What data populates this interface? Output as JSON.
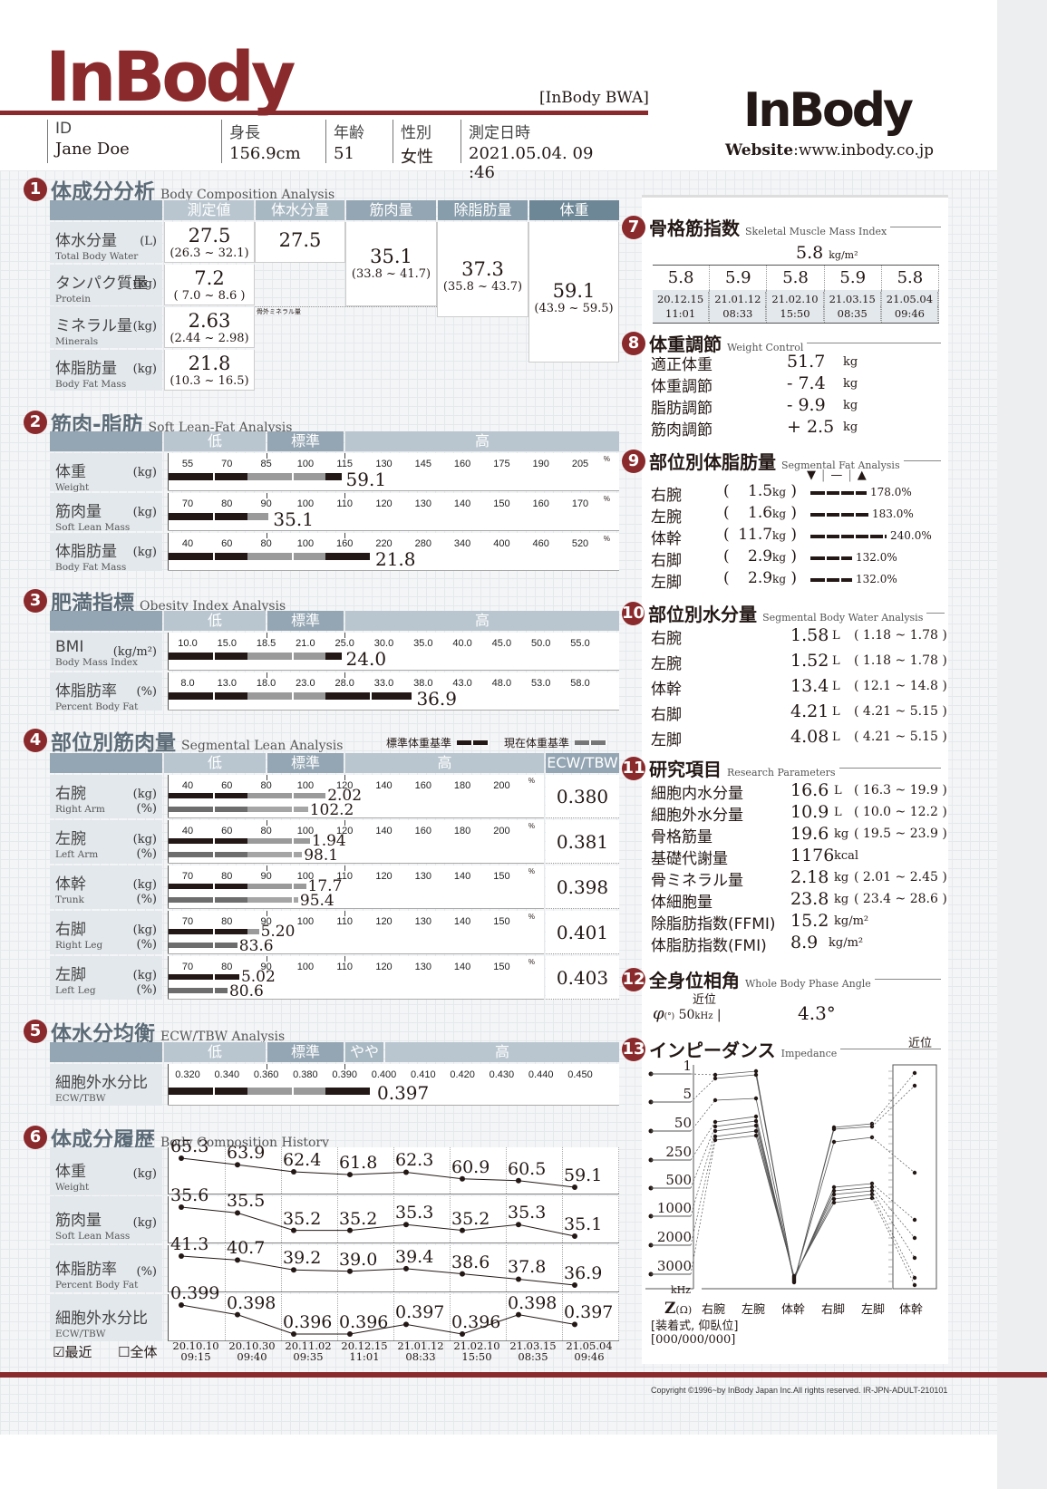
{
  "header": {
    "logo": "InBody",
    "model": "[InBody BWA]",
    "logo_right": "InBody",
    "website_label": "Website",
    "website_url": ":www.inbody.co.jp",
    "fields": [
      {
        "key": "ID",
        "value": "Jane Doe"
      },
      {
        "key": "身長",
        "value": "156.9cm"
      },
      {
        "key": "年齢",
        "value": "51"
      },
      {
        "key": "性別",
        "value": "女性"
      },
      {
        "key": "測定日時",
        "value": "2021.05.04. 09 :46"
      }
    ]
  },
  "sections": {
    "s1": {
      "num": "1",
      "jp": "体成分分析",
      "en": "Body Composition Analysis"
    },
    "s2": {
      "num": "2",
      "jp": "筋肉-脂肪",
      "en": "Soft Lean-Fat Analysis"
    },
    "s3": {
      "num": "3",
      "jp": "肥満指標",
      "en": "Obesity Index Analysis"
    },
    "s4": {
      "num": "4",
      "jp": "部位別筋肉量",
      "en": "Segmental Lean Analysis"
    },
    "s5": {
      "num": "5",
      "jp": "体水分均衡",
      "en": "ECW/TBW Analysis"
    },
    "s6": {
      "num": "6",
      "jp": "体成分履歴",
      "en": "Body Composition History"
    },
    "s7": {
      "num": "7",
      "jp": "骨格筋指数",
      "en": "Skeletal Muscle Mass Index"
    },
    "s8": {
      "num": "8",
      "jp": "体重調節",
      "en": "Weight Control"
    },
    "s9": {
      "num": "9",
      "jp": "部位別体脂肪量",
      "en": "Segmental Fat Analysis"
    },
    "s10": {
      "num": "10",
      "jp": "部位別水分量",
      "en": "Segmental Body Water Analysis"
    },
    "s11": {
      "num": "11",
      "jp": "研究項目",
      "en": "Research Parameters"
    },
    "s12": {
      "num": "12",
      "jp": "全身位相角",
      "en": "Whole Body Phase Angle"
    },
    "s13": {
      "num": "13",
      "jp": "インピーダンス",
      "en": "Impedance"
    }
  },
  "bca": {
    "headers": [
      "測定値",
      "体水分量",
      "筋肉量",
      "除脂肪量",
      "体重"
    ],
    "rows": [
      {
        "jp": "体水分量",
        "en": "Total Body Water",
        "unit": "(L)",
        "value": "27.5",
        "range": "(26.3 ~ 32.1)"
      },
      {
        "jp": "タンパク質量",
        "en": "Protein",
        "unit": "(kg)",
        "value": "7.2",
        "range": "( 7.0 ~ 8.6 )"
      },
      {
        "jp": "ミネラル量",
        "en": "Minerals",
        "unit": "(kg)",
        "value": "2.63",
        "range": "(2.44 ~ 2.98)"
      },
      {
        "jp": "体脂肪量",
        "en": "Body Fat Mass",
        "unit": "(kg)",
        "value": "21.8",
        "range": "(10.3 ~ 16.5)"
      }
    ],
    "tbw": "27.5",
    "slm": "35.1",
    "slm_range": "(33.8 ~ 41.7)",
    "ffm": "37.3",
    "ffm_range": "(35.8 ~ 43.7)",
    "weight": "59.1",
    "weight_range": "(43.9 ~ 59.5)",
    "bone_note": "骨外ミネラル量"
  },
  "range_headers": {
    "low": "低",
    "normal": "標準",
    "high": "高",
    "slightly_high": "やや高",
    "ecw": "ECW/TBW"
  },
  "slf": [
    {
      "jp": "体重",
      "en": "Weight",
      "unit": "(kg)",
      "ticks": [
        "55",
        "70",
        "85",
        "100",
        "115",
        "130",
        "145",
        "160",
        "175",
        "190",
        "205"
      ],
      "value": "59.1",
      "pos": 4.4
    },
    {
      "jp": "筋肉量",
      "en": "Soft Lean Mass",
      "unit": "(kg)",
      "ticks": [
        "70",
        "80",
        "90",
        "100",
        "110",
        "120",
        "130",
        "140",
        "150",
        "160",
        "170"
      ],
      "value": "35.1",
      "pos": 2.55
    },
    {
      "jp": "体脂肪量",
      "en": "Body Fat Mass",
      "unit": "(kg)",
      "ticks": [
        "40",
        "60",
        "80",
        "100",
        "160",
        "220",
        "280",
        "340",
        "400",
        "460",
        "520"
      ],
      "value": "21.8",
      "pos": 5.15
    }
  ],
  "obesity": [
    {
      "jp": "BMI",
      "en": "Body Mass Index",
      "unit": "(kg/m²)",
      "ticks": [
        "10.0",
        "15.0",
        "18.5",
        "21.0",
        "25.0",
        "30.0",
        "35.0",
        "40.0",
        "45.0",
        "50.0",
        "55.0"
      ],
      "value": "24.0",
      "pos": 4.4
    },
    {
      "jp": "体脂肪率",
      "en": "Percent Body Fat",
      "unit": "(%)",
      "ticks": [
        "8.0",
        "13.0",
        "18.0",
        "23.0",
        "28.0",
        "33.0",
        "38.0",
        "43.0",
        "48.0",
        "53.0",
        "58.0"
      ],
      "value": "36.9",
      "pos": 6.2
    }
  ],
  "segmental_lean": {
    "legend_std": "標準体重基準",
    "legend_cur": "現在体重基準",
    "rows": [
      {
        "jp": "右腕",
        "en": "Right Arm",
        "ticks": [
          "40",
          "60",
          "80",
          "100",
          "120",
          "140",
          "160",
          "180",
          "200"
        ],
        "kg": "2.02",
        "kg_pos": 4.0,
        "pct": "102.2",
        "pct_pos": 3.55,
        "ecw": "0.380"
      },
      {
        "jp": "左腕",
        "en": "Left Arm",
        "ticks": [
          "40",
          "60",
          "80",
          "100",
          "120",
          "140",
          "160",
          "180",
          "200"
        ],
        "kg": "1.94",
        "kg_pos": 3.6,
        "pct": "98.1",
        "pct_pos": 3.4,
        "ecw": "0.381"
      },
      {
        "jp": "体幹",
        "en": "Trunk",
        "ticks": [
          "70",
          "80",
          "90",
          "100",
          "110",
          "120",
          "130",
          "140",
          "150"
        ],
        "kg": "17.7",
        "kg_pos": 3.5,
        "pct": "95.4",
        "pct_pos": 3.3,
        "ecw": "0.398"
      },
      {
        "jp": "右脚",
        "en": "Right Leg",
        "ticks": [
          "70",
          "80",
          "90",
          "100",
          "110",
          "120",
          "130",
          "140",
          "150"
        ],
        "kg": "5.20",
        "kg_pos": 2.3,
        "pct": "83.6",
        "pct_pos": 1.75,
        "ecw": "0.401"
      },
      {
        "jp": "左脚",
        "en": "Left Leg",
        "ticks": [
          "70",
          "80",
          "90",
          "100",
          "110",
          "120",
          "130",
          "140",
          "150"
        ],
        "kg": "5.02",
        "kg_pos": 1.8,
        "pct": "80.6",
        "pct_pos": 1.5,
        "ecw": "0.403"
      }
    ]
  },
  "ecw": {
    "jp": "細胞外水分比",
    "en": "ECW/TBW",
    "ticks": [
      "0.320",
      "0.340",
      "0.360",
      "0.380",
      "0.390",
      "0.400",
      "0.410",
      "0.420",
      "0.430",
      "0.440",
      "0.450"
    ],
    "value": "0.397",
    "pos": 5.15
  },
  "history": {
    "rows": [
      {
        "jp": "体重",
        "en": "Weight",
        "unit": "(kg)",
        "values": [
          "65.3",
          "63.9",
          "62.4",
          "61.8",
          "62.3",
          "60.9",
          "60.5",
          "59.1"
        ]
      },
      {
        "jp": "筋肉量",
        "en": "Soft Lean Mass",
        "unit": "(kg)",
        "values": [
          "35.6",
          "35.5",
          "35.2",
          "35.2",
          "35.3",
          "35.2",
          "35.3",
          "35.1"
        ]
      },
      {
        "jp": "体脂肪率",
        "en": "Percent Body Fat",
        "unit": "(%)",
        "values": [
          "41.3",
          "40.7",
          "39.2",
          "39.0",
          "39.4",
          "38.6",
          "37.8",
          "36.9"
        ]
      },
      {
        "jp": "細胞外水分比",
        "en": "ECW/TBW",
        "unit": "",
        "values": [
          "0.399",
          "0.398",
          "0.396",
          "0.396",
          "0.397",
          "0.396",
          "0.398",
          "0.397"
        ]
      }
    ],
    "dates": [
      [
        "20.10.10",
        "09:15"
      ],
      [
        "20.10.30",
        "09:40"
      ],
      [
        "20.11.02",
        "09:35"
      ],
      [
        "20.12.15",
        "11:01"
      ],
      [
        "21.01.12",
        "08:33"
      ],
      [
        "21.02.10",
        "15:50"
      ],
      [
        "21.03.15",
        "08:35"
      ],
      [
        "21.05.04",
        "09:46"
      ]
    ],
    "recent_label": "最近",
    "all_label": "全体"
  },
  "smi": {
    "value": "5.8",
    "unit": "kg/m²",
    "history": [
      "5.8",
      "5.9",
      "5.8",
      "5.9",
      "5.8"
    ],
    "dates": [
      [
        "20.12.15",
        "11:01"
      ],
      [
        "21.01.12",
        "08:33"
      ],
      [
        "21.02.10",
        "15:50"
      ],
      [
        "21.03.15",
        "08:35"
      ],
      [
        "21.05.04",
        "09:46"
      ]
    ]
  },
  "weight_control": [
    {
      "k": "適正体重",
      "v": "51.7",
      "u": "kg"
    },
    {
      "k": "体重調節",
      "v": "- 7.4",
      "u": "kg"
    },
    {
      "k": "脂肪調節",
      "v": "- 9.9",
      "u": "kg"
    },
    {
      "k": "筋肉調節",
      "v": "+ 2.5",
      "u": "kg"
    }
  ],
  "segmental_fat": {
    "legend": [
      "▼",
      "|",
      "—",
      "|",
      "▲"
    ],
    "rows": [
      {
        "k": "右腕",
        "kg": "1.5",
        "pct": "178.0%",
        "level": 0.178
      },
      {
        "k": "左腕",
        "kg": "1.6",
        "pct": "183.0%",
        "level": 0.183
      },
      {
        "k": "体幹",
        "kg": "11.7",
        "pct": "240.0%",
        "level": 0.24
      },
      {
        "k": "右脚",
        "kg": "2.9",
        "pct": "132.0%",
        "level": 0.132
      },
      {
        "k": "左脚",
        "kg": "2.9",
        "pct": "132.0%",
        "level": 0.132
      }
    ]
  },
  "segmental_water": [
    {
      "k": "右腕",
      "v": "1.58",
      "u": "L",
      "r": "( 1.18 ~ 1.78 )"
    },
    {
      "k": "左腕",
      "v": "1.52",
      "u": "L",
      "r": "( 1.18 ~ 1.78 )"
    },
    {
      "k": "体幹",
      "v": "13.4",
      "u": "L",
      "r": "( 12.1 ~ 14.8 )"
    },
    {
      "k": "右脚",
      "v": "4.21",
      "u": "L",
      "r": "( 4.21 ~ 5.15 )"
    },
    {
      "k": "左脚",
      "v": "4.08",
      "u": "L",
      "r": "( 4.21 ~ 5.15 )"
    }
  ],
  "research": [
    {
      "k": "細胞内水分量",
      "v": "16.6",
      "u": "L",
      "r": "( 16.3 ~ 19.9 )"
    },
    {
      "k": "細胞外水分量",
      "v": "10.9",
      "u": "L",
      "r": "( 10.0 ~ 12.2 )"
    },
    {
      "k": "骨格筋量",
      "v": "19.6",
      "u": "kg",
      "r": "( 19.5 ~ 23.9 )"
    },
    {
      "k": "基礎代謝量",
      "v": "1176",
      "u": "kcal",
      "r": ""
    },
    {
      "k": "骨ミネラル量",
      "v": "2.18",
      "u": "kg",
      "r": "( 2.01 ~ 2.45 )"
    },
    {
      "k": "体細胞量",
      "v": "23.8",
      "u": "kg",
      "r": "( 23.4 ~ 28.6 )"
    },
    {
      "k": "除脂肪指数(FFMI)",
      "v": "15.2",
      "u": "kg/m²",
      "r": ""
    },
    {
      "k": "体脂肪指数(FMI)",
      "v": "8.9",
      "u": "kg/m²",
      "r": ""
    }
  ],
  "phase_angle": {
    "pos_label": "近位",
    "symbol": "φ",
    "deg_unit": "(°)",
    "freq": "50",
    "freq_unit": "kHz",
    "value": "4.3°"
  },
  "impedance": {
    "pos_label": "近位",
    "freqs": [
      "1",
      "5",
      "50",
      "250",
      "500",
      "1000",
      "2000",
      "3000"
    ],
    "freq_unit": "kHz",
    "z_label": "Z",
    "z_unit": "(Ω)",
    "segments": [
      "右腕",
      "左腕",
      "体幹",
      "右脚",
      "左脚",
      "体幹"
    ],
    "posture": "[装着式, 仰臥位]",
    "code": "[000/000/000]"
  },
  "footer": {
    "copyright": "Copyright ©1996~by InBody Japan Inc.All rights reserved. IR-JPN-ADULT-210101"
  },
  "colors": {
    "brand": "#8b2a2c",
    "header_light": "#b9c6cf",
    "header_mid": "#94a6b3",
    "header_dark": "#6e8796"
  }
}
